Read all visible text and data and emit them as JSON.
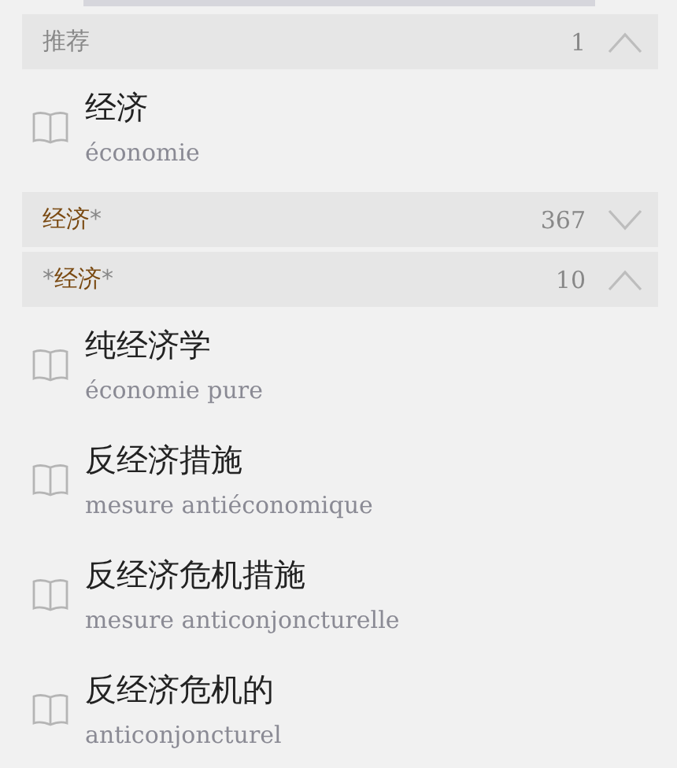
{
  "sections": [
    {
      "header": {
        "kind": "plain",
        "title": "推荐"
      },
      "count": "1",
      "expanded": true,
      "entries": [
        {
          "word": "经济",
          "translation": "économie"
        }
      ]
    },
    {
      "header": {
        "kind": "pattern",
        "term": "经济",
        "suffix": "*"
      },
      "count": "367",
      "expanded": false
    },
    {
      "header": {
        "kind": "pattern",
        "prefix": "*",
        "term": "经济",
        "suffix": "*"
      },
      "count": "10",
      "expanded": true,
      "entries": [
        {
          "word": "纯经济学",
          "translation": "économie pure"
        },
        {
          "word": "反经济措施",
          "translation": "mesure antiéconomique"
        },
        {
          "word": "反经济危机措施",
          "translation": "mesure anticonjoncturelle"
        },
        {
          "word": "反经济危机的",
          "translation": "anticonjoncturel"
        }
      ]
    }
  ]
}
